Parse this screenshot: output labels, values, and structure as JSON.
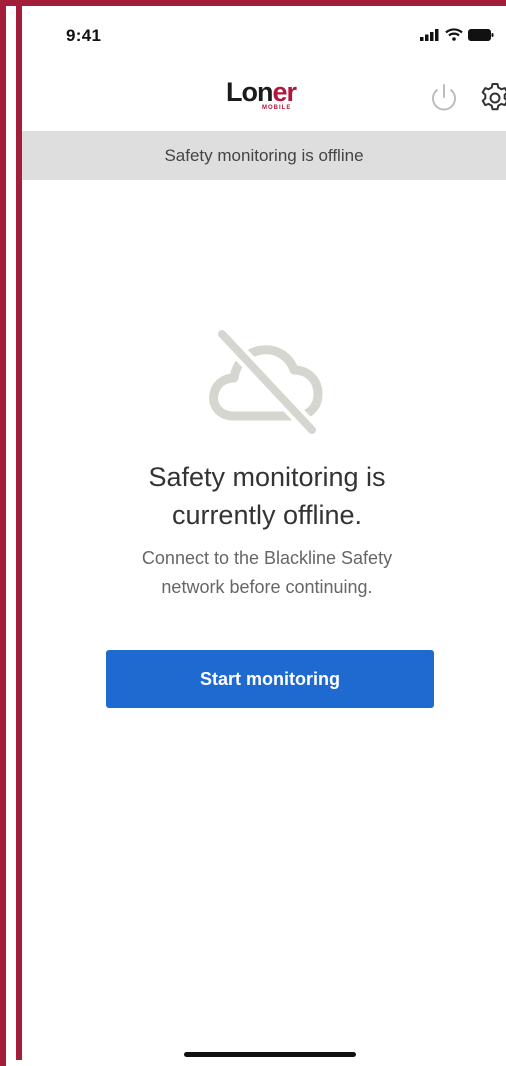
{
  "status_bar": {
    "time": "9:41",
    "icons": [
      "signal-icon",
      "wifi-icon",
      "battery-icon"
    ]
  },
  "header": {
    "logo": {
      "main": "Lon",
      "accent": "er",
      "sub": "MOBILE"
    },
    "icons": [
      "power-icon",
      "gear-icon"
    ]
  },
  "banner": {
    "text": "Safety monitoring is offline"
  },
  "main": {
    "icon": "cloud-offline-icon",
    "headline_line1": "Safety monitoring is",
    "headline_line2": "currently offline.",
    "subtext_line1": "Connect to the Blackline Safety",
    "subtext_line2": "network before continuing.",
    "button_label": "Start monitoring"
  },
  "colors": {
    "accent": "#1f6ad1",
    "brand": "#b0173a",
    "banner_bg": "#dedede"
  }
}
